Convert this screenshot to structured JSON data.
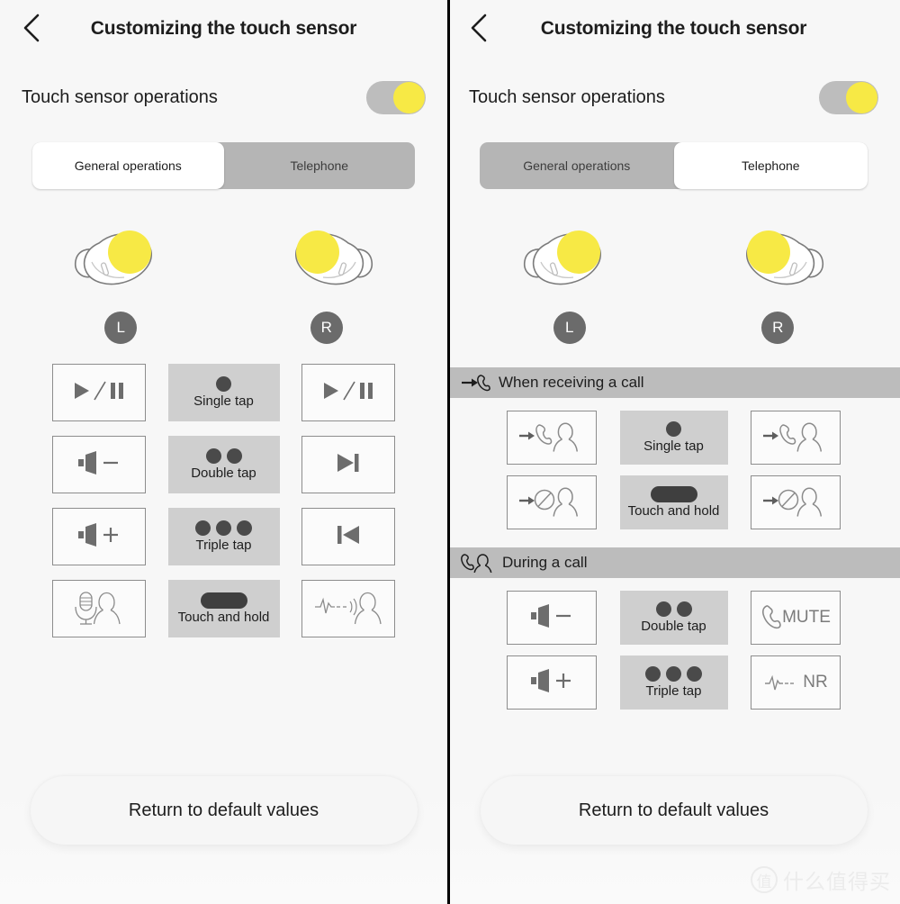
{
  "app": {
    "header": {
      "title": "Customizing the touch sensor",
      "back_icon": "chevron-left-icon"
    },
    "toggle": {
      "label": "Touch sensor operations",
      "state": "on",
      "knob_color": "#f7e945",
      "track_color": "#bdbdbd"
    },
    "tabs": [
      {
        "label": "General operations"
      },
      {
        "label": "Telephone"
      }
    ],
    "earbuds": [
      {
        "side": "L",
        "touch_color": "#f7e945"
      },
      {
        "side": "R",
        "touch_color": "#f7e945"
      }
    ],
    "bottom_button": {
      "label": "Return to default values"
    },
    "watermark": {
      "mark": "值",
      "text": "什么值得买"
    }
  },
  "left_panel": {
    "active_tab": "General operations",
    "rows": [
      {
        "left_action": "play-pause-icon",
        "gesture": {
          "label": "Single tap",
          "dots": 1,
          "type": "dots"
        },
        "right_action": "play-pause-icon"
      },
      {
        "left_action": "volume-down-icon",
        "gesture": {
          "label": "Double tap",
          "dots": 2,
          "type": "dots"
        },
        "right_action": "next-track-icon"
      },
      {
        "left_action": "volume-up-icon",
        "gesture": {
          "label": "Triple tap",
          "dots": 3,
          "type": "dots"
        },
        "right_action": "previous-track-icon"
      },
      {
        "left_action": "voice-assistant-icon",
        "gesture": {
          "label": "Touch and hold",
          "dots": 0,
          "type": "hold"
        },
        "right_action": "ambient-sound-icon"
      }
    ]
  },
  "right_panel": {
    "active_tab": "Telephone",
    "sections": [
      {
        "title": "When receiving a call",
        "icon": "incoming-call-icon",
        "rows": [
          {
            "left_action": "answer-call-icon",
            "gesture": {
              "label": "Single tap",
              "dots": 1,
              "type": "dots"
            },
            "right_action": "answer-call-icon"
          },
          {
            "left_action": "reject-call-icon",
            "gesture": {
              "label": "Touch and hold",
              "dots": 0,
              "type": "hold"
            },
            "right_action": "reject-call-icon"
          }
        ]
      },
      {
        "title": "During a call",
        "icon": "during-call-icon",
        "rows": [
          {
            "left_action": "volume-down-icon",
            "gesture": {
              "label": "Double tap",
              "dots": 2,
              "type": "dots"
            },
            "right_action": "mute-icon",
            "right_label": "MUTE"
          },
          {
            "left_action": "volume-up-icon",
            "gesture": {
              "label": "Triple tap",
              "dots": 3,
              "type": "dots"
            },
            "right_action": "noise-reduction-icon",
            "right_label": "NR"
          }
        ]
      }
    ]
  }
}
